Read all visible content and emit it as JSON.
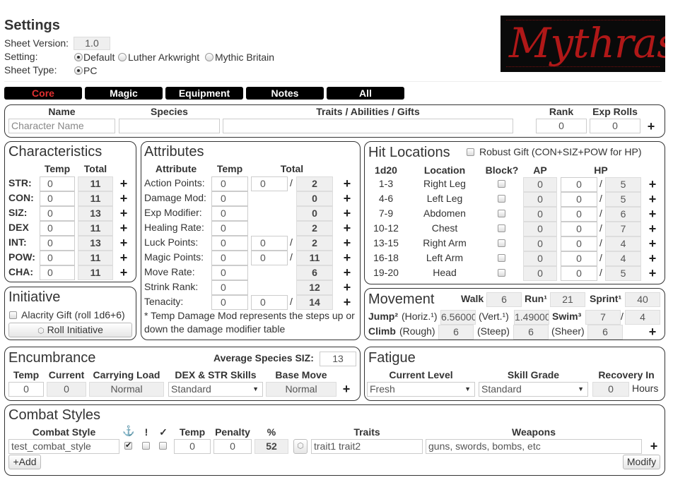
{
  "settings": {
    "title": "Settings",
    "sheet_version_label": "Sheet Version:",
    "sheet_version": "1.0",
    "setting_label": "Setting:",
    "setting_options": [
      "Default",
      "Luther Arkwright",
      "Mythic Britain"
    ],
    "sheet_type_label": "Sheet Type:",
    "sheet_type": "PC",
    "logo_text": "Mythras"
  },
  "tabs": [
    "Core",
    "Magic",
    "Equipment",
    "Notes",
    "All"
  ],
  "colors": {
    "active_tab": "#e03030",
    "logo_bg": "#0a0a0a",
    "logo_red": "#b01818"
  },
  "character": {
    "headers": [
      "Name",
      "Species",
      "Traits / Abilities / Gifts",
      "Rank",
      "Exp Rolls"
    ],
    "name_placeholder": "Character Name",
    "rank": "0",
    "exp_rolls": "0"
  },
  "characteristics": {
    "title": "Characteristics",
    "col_temp": "Temp",
    "col_total": "Total",
    "rows": [
      {
        "label": "STR:",
        "temp": "0",
        "total": "11"
      },
      {
        "label": "CON:",
        "temp": "0",
        "total": "11"
      },
      {
        "label": "SIZ:",
        "temp": "0",
        "total": "13"
      },
      {
        "label": "DEX",
        "temp": "0",
        "total": "11"
      },
      {
        "label": "INT:",
        "temp": "0",
        "total": "13"
      },
      {
        "label": "POW:",
        "temp": "0",
        "total": "11"
      },
      {
        "label": "CHA:",
        "temp": "0",
        "total": "11"
      }
    ]
  },
  "initiative": {
    "title": "Initiative",
    "alacrity_label": "Alacrity Gift (roll 1d6+6)",
    "roll_button": "Roll Initiative"
  },
  "attributes": {
    "title": "Attributes",
    "col_attribute": "Attribute",
    "col_temp": "Temp",
    "col_total": "Total",
    "rows": [
      {
        "label": "Action Points:",
        "temp": "0",
        "cur": "0",
        "total": "2"
      },
      {
        "label": "Damage Mod:",
        "temp": "0",
        "total": "0"
      },
      {
        "label": "Exp Modifier:",
        "temp": "0",
        "total": "0"
      },
      {
        "label": "Healing Rate:",
        "temp": "0",
        "total": "2"
      },
      {
        "label": "Luck Points:",
        "temp": "0",
        "cur": "0",
        "total": "2"
      },
      {
        "label": "Magic Points:",
        "temp": "0",
        "cur": "0",
        "total": "11"
      },
      {
        "label": "Move Rate:",
        "temp": "0",
        "total": "6"
      },
      {
        "label": "Strink Rank:",
        "temp": "0",
        "total": "12"
      },
      {
        "label": "Tenacity:",
        "temp": "0",
        "cur": "0",
        "total": "14"
      }
    ],
    "note": "* Temp Damage Mod represents the steps up or down the damage modifier table"
  },
  "hit_locations": {
    "title": "Hit Locations",
    "robust_label": "Robust Gift (CON+SIZ+POW for HP)",
    "headers": [
      "1d20",
      "Location",
      "Block?",
      "AP",
      "HP"
    ],
    "rows": [
      {
        "range": "1-3",
        "location": "Right Leg",
        "ap": "0",
        "hp_cur": "0",
        "hp_max": "5"
      },
      {
        "range": "4-6",
        "location": "Left Leg",
        "ap": "0",
        "hp_cur": "0",
        "hp_max": "5"
      },
      {
        "range": "7-9",
        "location": "Abdomen",
        "ap": "0",
        "hp_cur": "0",
        "hp_max": "6"
      },
      {
        "range": "10-12",
        "location": "Chest",
        "ap": "0",
        "hp_cur": "0",
        "hp_max": "7"
      },
      {
        "range": "13-15",
        "location": "Right Arm",
        "ap": "0",
        "hp_cur": "0",
        "hp_max": "4"
      },
      {
        "range": "16-18",
        "location": "Left Arm",
        "ap": "0",
        "hp_cur": "0",
        "hp_max": "4"
      },
      {
        "range": "19-20",
        "location": "Head",
        "ap": "0",
        "hp_cur": "0",
        "hp_max": "5"
      }
    ]
  },
  "movement": {
    "title": "Movement",
    "walk_label": "Walk",
    "walk": "6",
    "run_label": "Run¹",
    "run": "21",
    "sprint_label": "Sprint¹",
    "sprint": "40",
    "jump_label": "Jump²",
    "horiz_label": "(Horiz.¹)",
    "horiz": "6.56000",
    "vert_label": "(Vert.¹)",
    "vert": "1.49000",
    "swim_label": "Swim³",
    "swim": "7",
    "swim_max": "4",
    "climb_label": "Climb",
    "rough_label": "(Rough)",
    "rough": "6",
    "steep_label": "(Steep)",
    "steep": "6",
    "sheer_label": "(Sheer)",
    "sheer": "6"
  },
  "encumbrance": {
    "title": "Encumbrance",
    "avg_siz_label": "Average Species SIZ:",
    "avg_siz": "13",
    "headers": [
      "Temp",
      "Current",
      "Carrying Load",
      "DEX & STR Skills",
      "Base Move"
    ],
    "temp": "0",
    "current": "0",
    "carrying_load": "Normal",
    "skills": "Standard",
    "base_move": "Normal"
  },
  "fatigue": {
    "title": "Fatigue",
    "headers": [
      "Current Level",
      "Skill Grade",
      "Recovery In"
    ],
    "current_level": "Fresh",
    "skill_grade": "Standard",
    "recovery": "0",
    "recovery_unit": "Hours"
  },
  "combat_styles": {
    "title": "Combat Styles",
    "headers": [
      "Combat Style",
      "!",
      "✓",
      "Temp",
      "Penalty",
      "%",
      "Traits",
      "Weapons"
    ],
    "style": "test_combat_style",
    "temp": "0",
    "penalty": "0",
    "percent": "52",
    "traits": "trait1 trait2",
    "weapons": "guns, swords, bombs, etc",
    "add_button": "+Add",
    "modify_button": "Modify"
  }
}
